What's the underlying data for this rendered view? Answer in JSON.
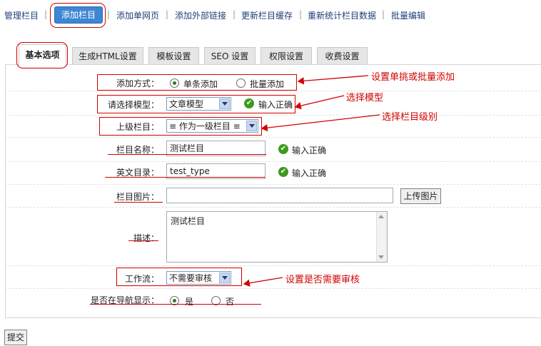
{
  "topnav": {
    "items": [
      "管理栏目",
      "添加栏目",
      "添加单网页",
      "添加外部链接",
      "更新栏目缓存",
      "重新统计栏目数据",
      "批量编辑"
    ],
    "separator": "|"
  },
  "tabs": [
    "基本选项",
    "生成HTML设置",
    "模板设置",
    "SEO 设置",
    "权限设置",
    "收费设置"
  ],
  "form": {
    "add_mode": {
      "label": "添加方式：",
      "opt1": "单条添加",
      "opt2": "批量添加"
    },
    "model": {
      "label": "请选择模型：",
      "value": "文章模型",
      "status": "输入正确"
    },
    "parent": {
      "label": "上级栏目：",
      "value": "≡ 作为一级栏目 ≡"
    },
    "name": {
      "label": "栏目名称：",
      "value": "测试栏目",
      "status": "输入正确"
    },
    "dir": {
      "label": "英文目录：",
      "value": "test_type",
      "status": "输入正确"
    },
    "image": {
      "label": "栏目图片：",
      "value": "",
      "upload_label": "上传图片"
    },
    "desc": {
      "label": "描述：",
      "value": "测试栏目"
    },
    "workflow": {
      "label": "工作流：",
      "value": "不需要审核"
    },
    "nav": {
      "label": "是否在导航显示：",
      "opt1": "是",
      "opt2": "否"
    }
  },
  "annotations": {
    "a1": "设置单挑或批量添加",
    "a2": "选择模型",
    "a3": "选择栏目级别",
    "a4": "设置是否需要审核"
  },
  "submit_label": "提交",
  "colors": {
    "accent": "#3e86d3",
    "annotation": "#d20000",
    "success": "#3d9a1e"
  }
}
